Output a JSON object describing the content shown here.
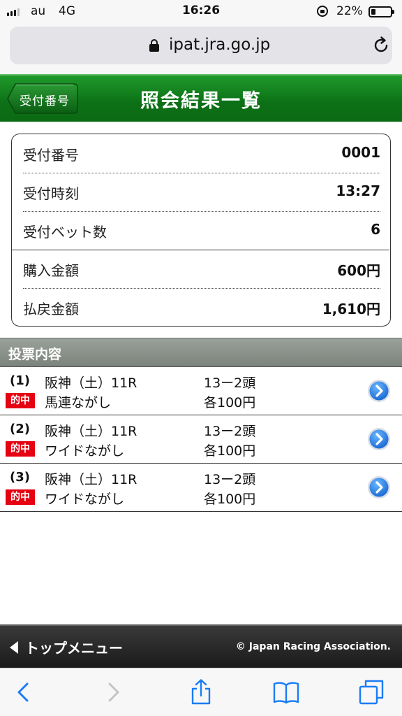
{
  "status_bar": {
    "carrier": "au",
    "network": "4G",
    "time": "16:26",
    "battery_percent": "22%",
    "battery_level": 0.22
  },
  "browser": {
    "url": "ipat.jra.go.jp"
  },
  "header": {
    "back_label": "受付番号",
    "title": "照会結果一覧"
  },
  "summary": {
    "rows": [
      {
        "label": "受付番号",
        "value": "0001"
      },
      {
        "label": "受付時刻",
        "value": "13:27"
      },
      {
        "label": "受付ベット数",
        "value": "6"
      },
      {
        "label": "購入金額",
        "value": "600円"
      },
      {
        "label": "払戻金額",
        "value": "1,610円"
      }
    ]
  },
  "bets_section": {
    "title": "投票内容",
    "items": [
      {
        "num": "(1)",
        "race": "阪神（土）11R",
        "combo": "13ー2頭",
        "badge": "的中",
        "type": "馬連ながし",
        "amount": "各100円"
      },
      {
        "num": "(2)",
        "race": "阪神（土）11R",
        "combo": "13ー2頭",
        "badge": "的中",
        "type": "ワイドながし",
        "amount": "各100円"
      },
      {
        "num": "(3)",
        "race": "阪神（土）11R",
        "combo": "13ー2頭",
        "badge": "的中",
        "type": "ワイドながし",
        "amount": "各100円"
      }
    ]
  },
  "footer": {
    "top_menu": "トップメニュー",
    "copyright": "© Japan Racing Association."
  },
  "colors": {
    "header_green": "#0c7016",
    "hit_red": "#e60012",
    "ios_blue": "#1a7cf5"
  }
}
